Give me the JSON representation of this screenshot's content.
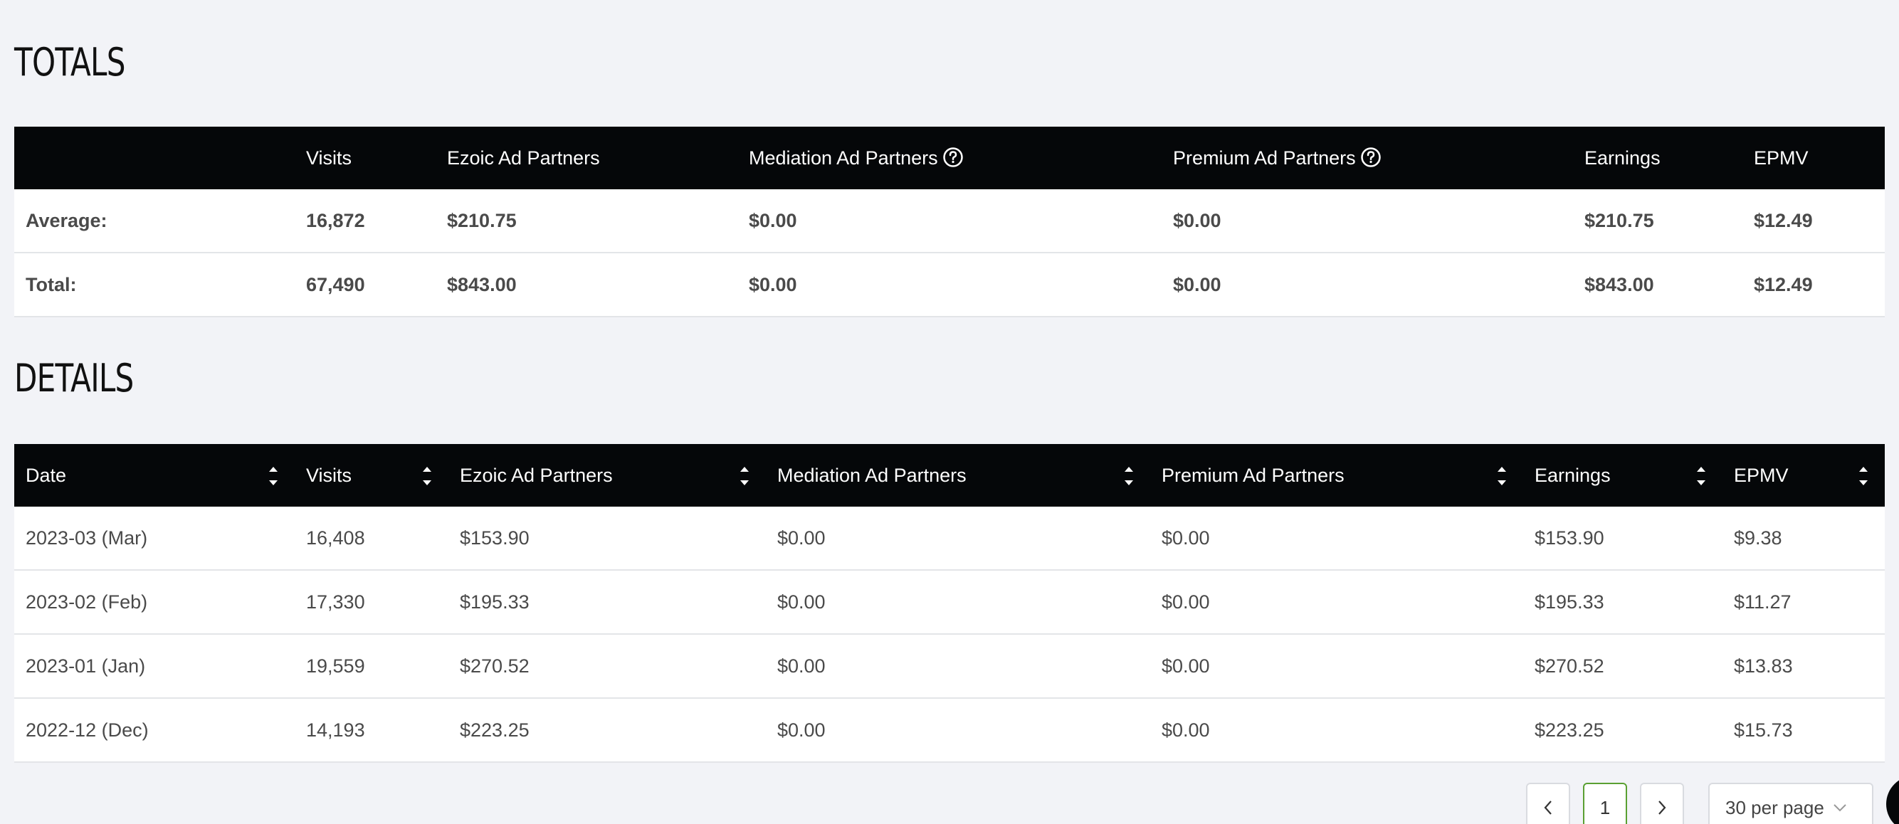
{
  "totals": {
    "title": "TOTALS",
    "headers": [
      "",
      "Visits",
      "Ezoic Ad Partners",
      "Mediation Ad Partners",
      "Premium Ad Partners",
      "Earnings",
      "EPMV"
    ],
    "rows": [
      [
        "Average:",
        "16,872",
        "$210.75",
        "$0.00",
        "$0.00",
        "$210.75",
        "$12.49"
      ],
      [
        "Total:",
        "67,490",
        "$843.00",
        "$0.00",
        "$0.00",
        "$843.00",
        "$12.49"
      ]
    ]
  },
  "details": {
    "title": "DETAILS",
    "headers": [
      "Date",
      "Visits",
      "Ezoic Ad Partners",
      "Mediation Ad Partners",
      "Premium Ad Partners",
      "Earnings",
      "EPMV"
    ],
    "rows": [
      [
        "2023-03 (Mar)",
        "16,408",
        "$153.90",
        "$0.00",
        "$0.00",
        "$153.90",
        "$9.38"
      ],
      [
        "2023-02 (Feb)",
        "17,330",
        "$195.33",
        "$0.00",
        "$0.00",
        "$195.33",
        "$11.27"
      ],
      [
        "2023-01 (Jan)",
        "19,559",
        "$270.52",
        "$0.00",
        "$0.00",
        "$270.52",
        "$13.83"
      ],
      [
        "2022-12 (Dec)",
        "14,193",
        "$223.25",
        "$0.00",
        "$0.00",
        "$223.25",
        "$15.73"
      ]
    ]
  },
  "pagination": {
    "prev": "<",
    "page": "1",
    "next": ">",
    "per_page": "30 per page"
  },
  "icons": {
    "help": "question-circle-icon",
    "sort": "sort-arrows-icon",
    "chevron": "chevron-down-icon"
  },
  "colors": {
    "header_bg": "#050709",
    "page_bg": "#f2f3f7",
    "active_page_border": "#5aa032"
  }
}
